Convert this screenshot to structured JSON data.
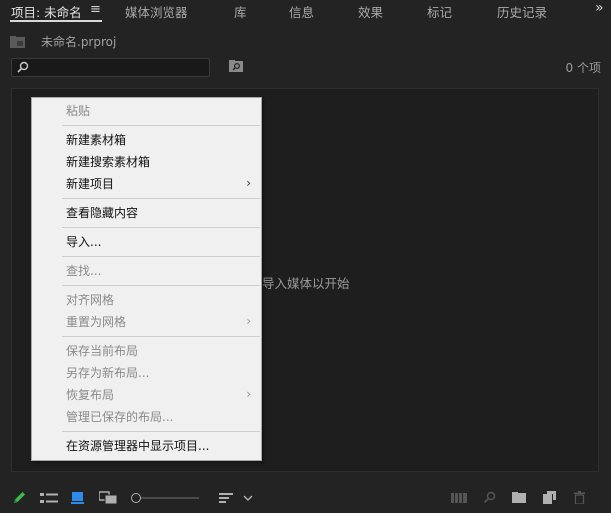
{
  "tabs": [
    {
      "label": "项目: 未命名",
      "active": true
    },
    {
      "label": "媒体浏览器"
    },
    {
      "label": "库"
    },
    {
      "label": "信息"
    },
    {
      "label": "效果"
    },
    {
      "label": "标记"
    },
    {
      "label": "历史记录"
    }
  ],
  "overflow_glyph": "»",
  "project": {
    "file_name": "未命名.prproj",
    "search_value": "",
    "item_count": "0 个项"
  },
  "empty_hint": "导入媒体以开始",
  "context_menu": {
    "items": [
      {
        "label": "粘贴",
        "enabled": false
      },
      {
        "label": "新建素材箱",
        "enabled": true
      },
      {
        "label": "新建搜索素材箱",
        "enabled": true
      },
      {
        "label": "新建项目",
        "enabled": true,
        "submenu": true
      },
      {
        "label": "查看隐藏内容",
        "enabled": true
      },
      {
        "label": "导入...",
        "enabled": true
      },
      {
        "label": "查找...",
        "enabled": false
      },
      {
        "label": "对齐网格",
        "enabled": false
      },
      {
        "label": "重置为网格",
        "enabled": false,
        "submenu": true
      },
      {
        "label": "保存当前布局",
        "enabled": false
      },
      {
        "label": "另存为新布局...",
        "enabled": false
      },
      {
        "label": "恢复布局",
        "enabled": false,
        "submenu": true
      },
      {
        "label": "管理已保存的布局...",
        "enabled": false
      },
      {
        "label": "在资源管理器中显示项目...",
        "enabled": true
      }
    ],
    "submenu_glyph": "›"
  },
  "toolbar": {
    "icons": [
      "pencil-icon",
      "list-view-icon",
      "icon-view-icon",
      "freeform-view-icon",
      "zoom-slider",
      "sort-icon",
      "automate-icon",
      "find-icon",
      "new-bin-icon",
      "new-item-icon",
      "trash-icon"
    ],
    "zoom_level": 0,
    "accent": "#2d8ceb",
    "pencil_color": "#3fb94a"
  }
}
